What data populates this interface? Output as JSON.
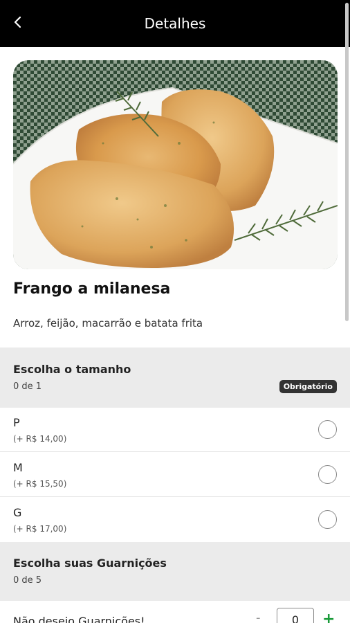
{
  "header": {
    "title": "Detalhes",
    "back_icon": "chevron-left-icon"
  },
  "product": {
    "name": "Frango a milanesa",
    "description": "Arroz, feijão, macarrão e batata frita",
    "image": "breaded-chicken-photo"
  },
  "size_section": {
    "title": "Escolha o tamanho",
    "count": "0 de 1",
    "badge": "Obrigatório",
    "options": [
      {
        "name": "P",
        "price": "(+ R$ 14,00)"
      },
      {
        "name": "M",
        "price": "(+ R$ 15,50)"
      },
      {
        "name": "G",
        "price": "(+ R$ 17,00)"
      }
    ]
  },
  "garnish_section": {
    "title": "Escolha suas Guarnições",
    "count": "0 de 5",
    "first_item": {
      "label": "Não desejo Guarnições!",
      "minus": "-",
      "quantity": "0",
      "plus": "+"
    }
  },
  "colors": {
    "accent_green": "#1a9b3a",
    "header_bg": "#000000",
    "section_bg": "#ebebeb"
  }
}
